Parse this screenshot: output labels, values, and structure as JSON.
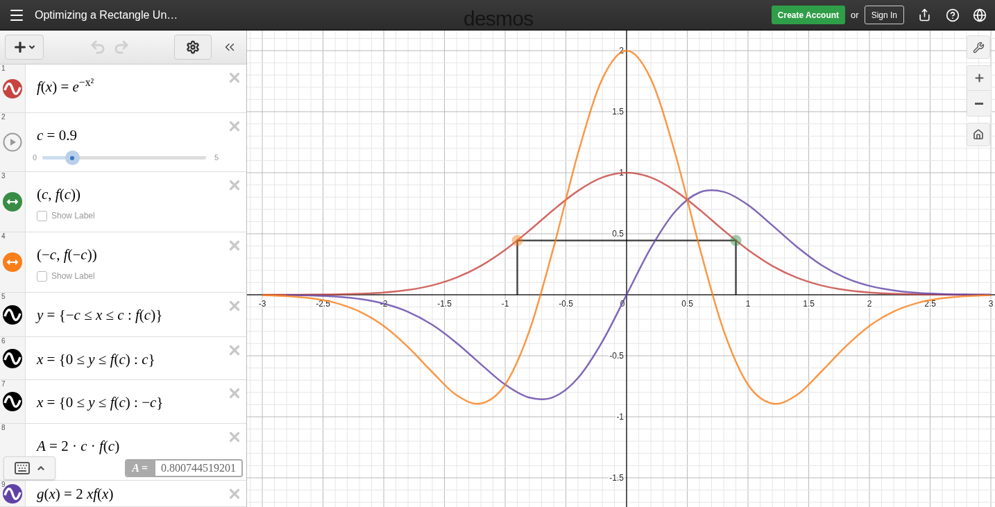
{
  "topbar": {
    "title": "Optimizing a Rectangle Un…",
    "logo": "desmos",
    "create_account": "Create Account",
    "or": "or",
    "sign_in": "Sign In"
  },
  "expressions": [
    {
      "number": "1",
      "kind": "function",
      "color": "#c74440",
      "latex": "*f*(*x*) = *e*$^{−x²}$"
    },
    {
      "number": "2",
      "kind": "slider",
      "latex": "*c* = 0.9",
      "slider": {
        "min": "0",
        "max": "5",
        "level": 0.18
      }
    },
    {
      "number": "3",
      "kind": "point",
      "color": "#388c46",
      "latex": "(*c*, *f*(*c*))",
      "show_label": {
        "label": "Show Label",
        "checked": false
      }
    },
    {
      "number": "4",
      "kind": "point",
      "color": "#fa7e19",
      "latex": "(−*c*, *f*(−*c*))",
      "show_label": {
        "label": "Show Label",
        "checked": false
      }
    },
    {
      "number": "5",
      "kind": "function",
      "color": "#000000",
      "latex": "*y* = {−*c* ≤ *x* ≤ *c* : *f*(*c*)}"
    },
    {
      "number": "6",
      "kind": "function",
      "color": "#000000",
      "latex": "*x* = {0 ≤ *y* ≤ *f*(*c*) : *c*}"
    },
    {
      "number": "7",
      "kind": "function",
      "color": "#000000",
      "latex": "*x* = {0 ≤ *y* ≤ *f*(*c*) : −*c*}"
    },
    {
      "number": "8",
      "kind": "value",
      "latex": "*A* = 2 · *c* · *f*(*c*)",
      "result": {
        "label": "*A*=",
        "value": "0.800744519201"
      }
    },
    {
      "number": "9",
      "kind": "function",
      "color": "#6042a6",
      "latex": "*g*(*x*) = 2 *xf*(*x*)"
    }
  ],
  "keyboard": {
    "expanded": false
  },
  "graph": {
    "chart_data": {
      "type": "line",
      "grid": true,
      "x": [
        -3,
        -2.8,
        -2.6,
        -2.4,
        -2.2,
        -2,
        -1.8,
        -1.6,
        -1.4,
        -1.2,
        -1,
        -0.8,
        -0.6,
        -0.4,
        -0.2,
        0,
        0.2,
        0.4,
        0.6,
        0.8,
        1,
        1.2,
        1.4,
        1.6,
        1.8,
        2,
        2.2,
        2.4,
        2.6,
        2.8,
        3
      ],
      "series": [
        {
          "color": "#c74440",
          "values": [
            0,
            0,
            0.001,
            0.003,
            0.008,
            0.018,
            0.039,
            0.077,
            0.141,
            0.237,
            0.368,
            0.527,
            0.698,
            0.852,
            0.961,
            1,
            0.961,
            0.852,
            0.698,
            0.527,
            0.368,
            0.237,
            0.141,
            0.077,
            0.039,
            0.018,
            0.008,
            0.003,
            0.001,
            0,
            0
          ]
        },
        {
          "color": "#6042a6",
          "values": [
            null,
            -0.002,
            -0.006,
            -0.015,
            -0.035,
            -0.073,
            -0.14,
            -0.246,
            -0.395,
            -0.569,
            -0.736,
            -0.843,
            -0.838,
            -0.682,
            -0.384,
            0,
            0.384,
            0.682,
            0.838,
            0.843,
            0.736,
            0.569,
            0.395,
            0.246,
            0.14,
            0.073,
            0.035,
            0.015,
            0.006,
            0.002,
            0.001
          ]
        },
        {
          "color": "#fa7e19",
          "values": [
            -0.004,
            -0.012,
            -0.029,
            -0.066,
            -0.137,
            -0.256,
            -0.428,
            -0.634,
            -0.823,
            -0.891,
            -0.736,
            -0.295,
            0.391,
            1.159,
            1.768,
            2,
            1.768,
            1.159,
            0.391,
            -0.295,
            -0.736,
            -0.891,
            -0.823,
            -0.634,
            -0.428,
            -0.256,
            -0.137,
            -0.066,
            -0.029,
            -0.012,
            -0.004
          ]
        }
      ],
      "xlim": [
        -3.126,
        3.034
      ],
      "ylim": [
        -1.739,
        2.165
      ],
      "xticks": [
        {
          "value": -3,
          "label": "-3"
        },
        {
          "value": -2.5,
          "label": "-2.5"
        },
        {
          "value": -2,
          "label": "-2"
        },
        {
          "value": -1.5,
          "label": "-1.5"
        },
        {
          "value": -1,
          "label": "-1"
        },
        {
          "value": -0.5,
          "label": "-0.5"
        },
        {
          "value": 0,
          "label": "0"
        },
        {
          "value": 0.5,
          "label": "0.5"
        },
        {
          "value": 1,
          "label": "1"
        },
        {
          "value": 1.5,
          "label": "1.5"
        },
        {
          "value": 2,
          "label": "2"
        },
        {
          "value": 2.5,
          "label": "2.5"
        },
        {
          "value": 3,
          "label": "3"
        }
      ],
      "yticks": [
        {
          "value": -1.5,
          "label": "-1.5"
        },
        {
          "value": -1,
          "label": "-1"
        },
        {
          "value": -0.5,
          "label": "-0.5"
        },
        {
          "value": 0.5,
          "label": "0.5"
        },
        {
          "value": 1,
          "label": "1"
        },
        {
          "value": 1.5,
          "label": "1.5"
        },
        {
          "value": 2,
          "label": "2"
        }
      ]
    }
  }
}
